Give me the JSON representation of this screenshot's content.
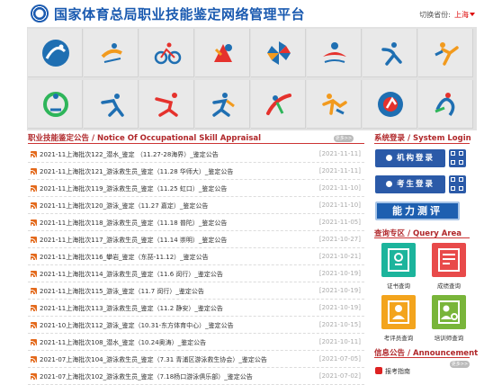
{
  "header": {
    "title": "国家体育总局职业技能鉴定网络管理平台",
    "province_label": "切换省份:",
    "province_value": "上海"
  },
  "banner": {
    "tiles": [
      {
        "icon": "gymnastics-icon",
        "color": "#1f6fb2"
      },
      {
        "icon": "rowing-icon",
        "color": "#f29a1d"
      },
      {
        "icon": "cycling-icon",
        "color": "#1f6fb2"
      },
      {
        "icon": "boxing-icon",
        "color": "#e5322d"
      },
      {
        "icon": "pinwheel-icon",
        "color": "#1f6fb2"
      },
      {
        "icon": "swimmer-icon",
        "color": "#e5322d"
      },
      {
        "icon": "dance-icon",
        "color": "#1f6fb2"
      },
      {
        "icon": "fencing-icon",
        "color": "#f29a1d"
      },
      {
        "icon": "yoga-icon",
        "color": "#2eb55a"
      },
      {
        "icon": "skating-icon",
        "color": "#1f6fb2"
      },
      {
        "icon": "sprint-icon",
        "color": "#e5322d"
      },
      {
        "icon": "running-icon",
        "color": "#1f6fb2"
      },
      {
        "icon": "javelin-icon",
        "color": "#e5322d"
      },
      {
        "icon": "leaping-icon",
        "color": "#f29a1d"
      },
      {
        "icon": "ballet-icon",
        "color": "#1f6fb2"
      },
      {
        "icon": "ball-icon",
        "color": "#1f6fb2"
      }
    ]
  },
  "notices": {
    "title": "职业技能鉴定公告 / Notice Of Occupational Skill Appraisal",
    "more": "更多>>",
    "items": [
      {
        "text": "2021-11上海批次122_潜水_鉴定 （11.27-28海界）_鉴定公告",
        "date": "[2021-11-11]"
      },
      {
        "text": "2021-11上海批次121_游泳救生员_鉴定（11.28 华师大）_鉴定公告",
        "date": "[2021-11-11]"
      },
      {
        "text": "2021-11上海批次119_游泳救生员_鉴定（11.25 虹口）_鉴定公告",
        "date": "[2021-11-10]"
      },
      {
        "text": "2021-11上海批次120_游泳_鉴定（11.27 嘉定）_鉴定公告",
        "date": "[2021-11-10]"
      },
      {
        "text": "2021-11上海批次118_游泳救生员_鉴定（11.18 普陀）_鉴定公告",
        "date": "[2021-11-05]"
      },
      {
        "text": "2021-11上海批次117_游泳救生员_鉴定（11.14 崇明）_鉴定公告",
        "date": "[2021-10-27]"
      },
      {
        "text": "2021-11上海批次116_攀岩_鉴定（东琵-11.12）_鉴定公告",
        "date": "[2021-10-21]"
      },
      {
        "text": "2021-11上海批次114_游泳救生员_鉴定（11.6 闵行）_鉴定公告",
        "date": "[2021-10-19]"
      },
      {
        "text": "2021-11上海批次115_游泳_鉴定（11.7 闵行）_鉴定公告",
        "date": "[2021-10-19]"
      },
      {
        "text": "2021-11上海批次113_游泳救生员_鉴定（11.2 静安）_鉴定公告",
        "date": "[2021-10-19]"
      },
      {
        "text": "2021-10上海批次112_游泳_鉴定（10.31-东方体育中心）_鉴定公告",
        "date": "[2021-10-15]"
      },
      {
        "text": "2021-11上海批次108_潜水_鉴定（10.24奥涛）_鉴定公告",
        "date": "[2021-10-11]"
      },
      {
        "text": "2021-07上海批次104_游泳救生员_鉴定（7.31 青浦区游泳救生协会）_鉴定公告",
        "date": "[2021-07-05]"
      },
      {
        "text": "2021-07上海批次102_游泳救生员_鉴定（7.18杨口游泳俱乐部）_鉴定公告",
        "date": "[2021-07-02]"
      }
    ]
  },
  "login": {
    "title": "系统登录 / System Login",
    "org_login": "机构登录",
    "candidate_login": "考生登录",
    "ability_test": "能力测评"
  },
  "query": {
    "title": "查询专区 / Query Area",
    "items": [
      {
        "label": "证书查询",
        "color": "#1cb49c"
      },
      {
        "label": "成绩查询",
        "color": "#e84a4a"
      },
      {
        "label": "考评员查询",
        "color": "#f3a41d"
      },
      {
        "label": "培训师查询",
        "color": "#79b53a"
      }
    ]
  },
  "announce": {
    "title": "信息公告 / Announcement",
    "more": "更多>>",
    "guide": "报考指南"
  }
}
